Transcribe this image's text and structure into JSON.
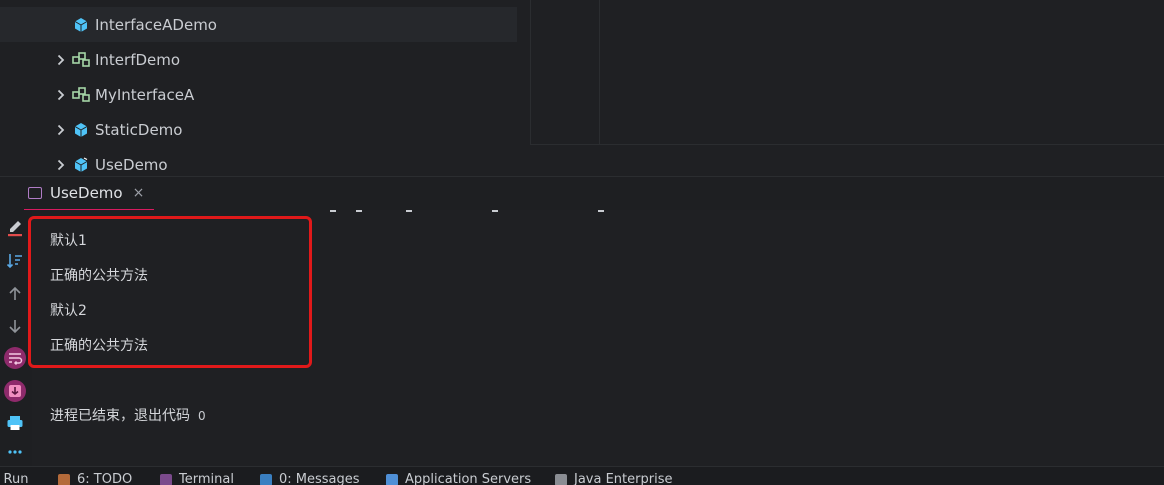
{
  "project_tree": {
    "items": [
      {
        "label": "InterfaceADemo",
        "icon": "class-icon",
        "expandable": false
      },
      {
        "label": "InterfDemo",
        "icon": "interface-icon",
        "expandable": true
      },
      {
        "label": "MyInterfaceA",
        "icon": "interface-icon",
        "expandable": true
      },
      {
        "label": "StaticDemo",
        "icon": "class-icon",
        "expandable": true
      },
      {
        "label": "UseDemo",
        "icon": "class-icon",
        "expandable": true
      }
    ]
  },
  "run_panel": {
    "tool_label": ": Run",
    "tab": {
      "title": "UseDemo",
      "close": "×"
    }
  },
  "console": {
    "lines": [
      "默认1",
      "正确的公共方法",
      "默认2",
      "正确的公共方法"
    ],
    "exit_text": "进程已结束，退出代码",
    "exit_code": "0"
  },
  "bottom_bar": {
    "run": ": Run",
    "todo": "6: TODO",
    "terminal": "Terminal",
    "messages": "0: Messages",
    "app_servers": "Application Servers",
    "java_enterprise": "Java Enterprise"
  },
  "colors": {
    "highlight_box": "#e0191a",
    "tab_underline": "#d81b60",
    "class_icon": "#4fc3f7",
    "interface_icon": "#a5d6a7"
  }
}
